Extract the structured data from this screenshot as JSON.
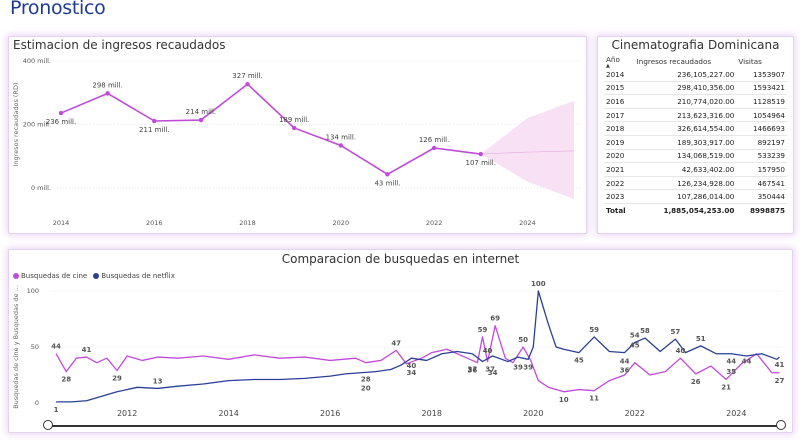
{
  "page": {
    "title": "Pronostico"
  },
  "colors": {
    "purple": "#c04bd9",
    "navy": "#2b3f96",
    "forecast_band": "#f8dcf3",
    "title_blue": "#1f3a93"
  },
  "revenue_chart": {
    "title": "Estimacion de ingresos recaudados",
    "chart_data": {
      "type": "line",
      "title": "Estimacion de ingresos recaudados",
      "ylabel": "Ingresos recaudados (RD)",
      "y_ticks": [
        "400 mill.",
        "200 mill.",
        "0 mill."
      ],
      "y_tick_values": [
        400,
        200,
        0
      ],
      "x_ticks": [
        "2014",
        "2016",
        "2018",
        "2020",
        "2022",
        "2024"
      ],
      "x_tick_values": [
        2014,
        2016,
        2018,
        2020,
        2022,
        2024
      ],
      "ylim": [
        0,
        400
      ],
      "xlim": [
        2014,
        2025
      ],
      "series": [
        {
          "x": [
            2014,
            2015,
            2016,
            2017,
            2018,
            2019,
            2020,
            2021,
            2022,
            2023
          ],
          "values": [
            236,
            298,
            211,
            214,
            327,
            189,
            134,
            43,
            126,
            107
          ],
          "labels": [
            "236 mill.",
            "298 mill.",
            "211 mill.",
            "214 mill.",
            "327 mill.",
            "189 mill.",
            "134 mill.",
            "43 mill.",
            "126 mill.",
            "107 mill."
          ]
        }
      ],
      "forecast": {
        "x": [
          2023,
          2024,
          2025
        ],
        "upper": [
          107,
          220,
          275
        ],
        "center": [
          107,
          113,
          117
        ],
        "lower": [
          107,
          20,
          -50
        ]
      }
    }
  },
  "table": {
    "title": "Cinematografia Dominicana",
    "columns": [
      "Año",
      "Ingresos recaudados",
      "Visitas"
    ],
    "rows": [
      [
        "2014",
        "236,105,227.00",
        "1353907"
      ],
      [
        "2015",
        "298,410,356.00",
        "1593421"
      ],
      [
        "2016",
        "210,774,020.00",
        "1128519"
      ],
      [
        "2017",
        "213,623,316.00",
        "1054964"
      ],
      [
        "2018",
        "326,614,554.00",
        "1466693"
      ],
      [
        "2019",
        "189,303,917.00",
        "892197"
      ],
      [
        "2020",
        "134,068,519.00",
        "533239"
      ],
      [
        "2021",
        "42,633,402.00",
        "157950"
      ],
      [
        "2022",
        "126,234,928.00",
        "467541"
      ],
      [
        "2023",
        "107,286,014.00",
        "350444"
      ]
    ],
    "total": [
      "Total",
      "1,885,054,253.00",
      "8998875"
    ]
  },
  "search_chart": {
    "title": "Comparacion de busquedas en internet",
    "chart_data": {
      "type": "line",
      "title": "Comparacion de busquedas en internet",
      "ylabel": "Busquedas de cine y Busquedas de ...",
      "y_ticks": [
        "100",
        "50",
        "0"
      ],
      "y_tick_values": [
        100,
        50,
        0
      ],
      "x_ticks": [
        "2012",
        "2014",
        "2016",
        "2018",
        "2020",
        "2022",
        "2024"
      ],
      "x_tick_values": [
        2012,
        2014,
        2016,
        2018,
        2020,
        2022,
        2024
      ],
      "xlim": [
        2010.5,
        2024.9
      ],
      "ylim": [
        0,
        100
      ],
      "series": [
        {
          "name": "Busquedas de cine",
          "color": "#c04bd9",
          "x": [
            2010.6,
            2010.8,
            2011.0,
            2011.2,
            2011.4,
            2011.6,
            2011.8,
            2012.0,
            2012.3,
            2012.6,
            2013.0,
            2013.5,
            2014.0,
            2014.5,
            2015.0,
            2015.5,
            2016.0,
            2016.5,
            2016.7,
            2017.0,
            2017.3,
            2017.5,
            2017.8,
            2018.0,
            2018.3,
            2018.6,
            2018.9,
            2019.0,
            2019.1,
            2019.25,
            2019.45,
            2019.6,
            2019.8,
            2019.95,
            2020.1,
            2020.3,
            2020.6,
            2020.9,
            2021.2,
            2021.5,
            2021.8,
            2022.0,
            2022.3,
            2022.6,
            2022.9,
            2023.2,
            2023.5,
            2023.8,
            2024.1,
            2024.4,
            2024.7,
            2024.85
          ],
          "values": [
            44,
            28,
            40,
            41,
            36,
            40,
            29,
            42,
            38,
            41,
            40,
            42,
            39,
            43,
            40,
            41,
            38,
            40,
            36,
            38,
            47,
            35,
            40,
            45,
            48,
            42,
            36,
            59,
            37,
            69,
            40,
            36,
            50,
            38,
            20,
            14,
            10,
            12,
            11,
            20,
            25,
            36,
            25,
            28,
            40,
            26,
            33,
            21,
            35,
            44,
            27,
            27
          ]
        },
        {
          "name": "Busquedas de netflix",
          "color": "#2b3f96",
          "x": [
            2010.6,
            2010.9,
            2011.2,
            2011.5,
            2011.8,
            2012.2,
            2012.6,
            2013.0,
            2013.5,
            2014.0,
            2014.5,
            2015.0,
            2015.5,
            2016.0,
            2016.3,
            2016.6,
            2016.9,
            2017.2,
            2017.4,
            2017.6,
            2017.9,
            2018.2,
            2018.5,
            2018.8,
            2019.0,
            2019.2,
            2019.5,
            2019.7,
            2019.9,
            2020.0,
            2020.1,
            2020.3,
            2020.45,
            2020.6,
            2020.9,
            2021.2,
            2021.5,
            2021.8,
            2022.0,
            2022.2,
            2022.5,
            2022.8,
            2023.0,
            2023.3,
            2023.6,
            2023.9,
            2024.2,
            2024.5,
            2024.8,
            2024.85
          ],
          "values": [
            1,
            1,
            2,
            6,
            10,
            14,
            13,
            15,
            17,
            20,
            21,
            21,
            22,
            24,
            26,
            27,
            28,
            30,
            34,
            40,
            38,
            44,
            46,
            44,
            37,
            42,
            37,
            41,
            39,
            50,
            100,
            70,
            50,
            48,
            45,
            59,
            46,
            45,
            54,
            58,
            46,
            57,
            45,
            51,
            44,
            44,
            42,
            44,
            39,
            41
          ]
        }
      ],
      "data_labels": [
        {
          "series": 0,
          "x": 2010.6,
          "y": 44,
          "text": "44"
        },
        {
          "series": 0,
          "x": 2010.8,
          "y": 28,
          "text": "28"
        },
        {
          "series": 0,
          "x": 2011.2,
          "y": 41,
          "text": "41"
        },
        {
          "series": 0,
          "x": 2011.8,
          "y": 29,
          "text": "29"
        },
        {
          "series": 0,
          "x": 2016.7,
          "y": 20,
          "text": "20"
        },
        {
          "series": 0,
          "x": 2017.3,
          "y": 47,
          "text": "47"
        },
        {
          "series": 0,
          "x": 2018.8,
          "y": 37,
          "text": "37"
        },
        {
          "series": 0,
          "x": 2019.0,
          "y": 59,
          "text": "59"
        },
        {
          "series": 0,
          "x": 2019.1,
          "y": 40,
          "text": "40"
        },
        {
          "series": 0,
          "x": 2019.15,
          "y": 37,
          "text": "37"
        },
        {
          "series": 0,
          "x": 2019.25,
          "y": 69,
          "text": "69"
        },
        {
          "series": 0,
          "x": 2019.8,
          "y": 50,
          "text": "50"
        },
        {
          "series": 0,
          "x": 2019.7,
          "y": 39,
          "text": "39"
        },
        {
          "series": 0,
          "x": 2020.6,
          "y": 10,
          "text": "10"
        },
        {
          "series": 0,
          "x": 2021.2,
          "y": 11,
          "text": "11"
        },
        {
          "series": 0,
          "x": 2021.8,
          "y": 36,
          "text": "36"
        },
        {
          "series": 0,
          "x": 2022.0,
          "y": 45,
          "text": "45"
        },
        {
          "series": 0,
          "x": 2022.9,
          "y": 40,
          "text": "40"
        },
        {
          "series": 0,
          "x": 2023.2,
          "y": 26,
          "text": "26"
        },
        {
          "series": 0,
          "x": 2023.8,
          "y": 21,
          "text": "21"
        },
        {
          "series": 0,
          "x": 2023.9,
          "y": 35,
          "text": "35"
        },
        {
          "series": 0,
          "x": 2024.85,
          "y": 27,
          "text": "27"
        },
        {
          "series": 1,
          "x": 2010.6,
          "y": 1,
          "text": "1"
        },
        {
          "series": 1,
          "x": 2012.6,
          "y": 13,
          "text": "13"
        },
        {
          "series": 1,
          "x": 2016.7,
          "y": 28,
          "text": "28"
        },
        {
          "series": 1,
          "x": 2017.6,
          "y": 40,
          "text": "40"
        },
        {
          "series": 1,
          "x": 2017.6,
          "y": 34,
          "text": "34"
        },
        {
          "series": 1,
          "x": 2018.8,
          "y": 36,
          "text": "36"
        },
        {
          "series": 1,
          "x": 2019.2,
          "y": 34,
          "text": "34"
        },
        {
          "series": 1,
          "x": 2019.9,
          "y": 39,
          "text": "39"
        },
        {
          "series": 1,
          "x": 2020.1,
          "y": 100,
          "text": "100"
        },
        {
          "series": 1,
          "x": 2020.9,
          "y": 45,
          "text": "45"
        },
        {
          "series": 1,
          "x": 2021.2,
          "y": 59,
          "text": "59"
        },
        {
          "series": 1,
          "x": 2021.8,
          "y": 44,
          "text": "44"
        },
        {
          "series": 1,
          "x": 2022.0,
          "y": 54,
          "text": "54"
        },
        {
          "series": 1,
          "x": 2022.2,
          "y": 58,
          "text": "58"
        },
        {
          "series": 1,
          "x": 2022.8,
          "y": 57,
          "text": "57"
        },
        {
          "series": 1,
          "x": 2023.3,
          "y": 51,
          "text": "51"
        },
        {
          "series": 1,
          "x": 2023.9,
          "y": 44,
          "text": "44"
        },
        {
          "series": 1,
          "x": 2024.2,
          "y": 44,
          "text": "44"
        },
        {
          "series": 1,
          "x": 2024.85,
          "y": 41,
          "text": "41"
        }
      ]
    }
  }
}
